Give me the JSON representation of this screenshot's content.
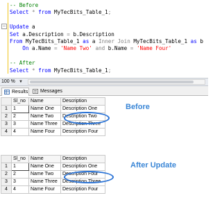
{
  "editor": {
    "lines": {
      "c_before": "-- Before",
      "sel1_kw": "Select",
      "sel1_star": " * ",
      "sel1_from": "from",
      "sel1_table": " MyTecBits_Table_1",
      "sel1_semi": ";",
      "upd_kw": "Update",
      "upd_alias": " a",
      "set_kw": "Set",
      "set_expr1": " a.Description ",
      "set_eq": "=",
      "set_expr2": " b.Description",
      "from_kw": "From",
      "from_t1": " MyTecBits_Table_1 ",
      "as1": "as",
      "from_a": " a ",
      "inner": "Inner Join",
      "from_t2": " MyTecBits_Table_1 ",
      "as2": "as",
      "from_b": " b",
      "on_kw": "On",
      "on_l1": " a.Name ",
      "on_eq1": "=",
      "on_v1": "'Name Two'",
      "and_kw": " and ",
      "on_l2": "b.Name ",
      "on_eq2": "=",
      "on_v2": "'Name Four'",
      "c_after": "-- After",
      "sel2_kw": "Select",
      "sel2_star": " * ",
      "sel2_from": "from",
      "sel2_table": " MyTecBits_Table_1",
      "sel2_semi": ";"
    },
    "collapse_glyph": "−"
  },
  "zoom": {
    "label": "100 %",
    "arrow": "▼"
  },
  "tabs": {
    "results": "Results",
    "messages": "Messages"
  },
  "grid_headers": [
    "Sl_no",
    "Name",
    "Description"
  ],
  "grid_before": [
    {
      "row": "1",
      "sl": "1",
      "name": "Name One",
      "desc": "Description One"
    },
    {
      "row": "2",
      "sl": "2",
      "name": "Name Two",
      "desc": "Description Two"
    },
    {
      "row": "3",
      "sl": "3",
      "name": "Name Three",
      "desc": "Description Three"
    },
    {
      "row": "4",
      "sl": "4",
      "name": "Name Four",
      "desc": "Description Four"
    }
  ],
  "grid_after": [
    {
      "row": "1",
      "sl": "1",
      "name": "Name One",
      "desc": "Description One"
    },
    {
      "row": "2",
      "sl": "2",
      "name": "Name Two",
      "desc": "Description Four"
    },
    {
      "row": "3",
      "sl": "3",
      "name": "Name Three",
      "desc": "Description Three"
    },
    {
      "row": "4",
      "sl": "4",
      "name": "Name Four",
      "desc": "Description Four"
    }
  ],
  "annotations": {
    "before": "Before",
    "after": "After Update"
  },
  "colors": {
    "comment": "#008000",
    "keyword": "#0000ff",
    "string": "#ff0000",
    "annotation": "#3a86d6",
    "highlight_ring": "#2a73d6"
  }
}
